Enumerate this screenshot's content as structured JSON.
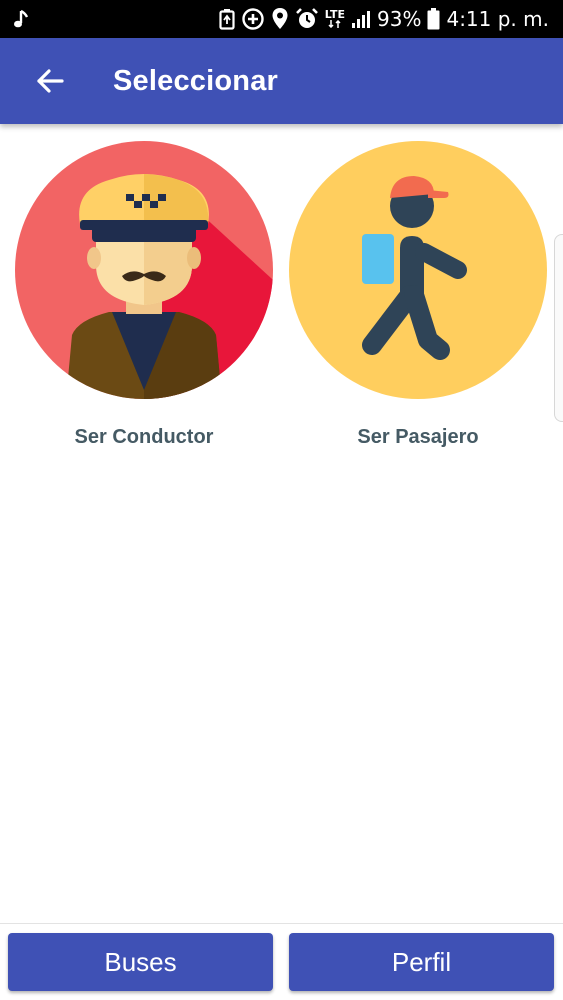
{
  "status_bar": {
    "battery_percent": "93%",
    "time": "4:11 p. m.",
    "network": "LTE",
    "icons": [
      "music-note-icon",
      "battery-saver-icon",
      "add-circle-icon",
      "location-icon",
      "alarm-icon",
      "lte-icon",
      "signal-icon",
      "battery-icon"
    ]
  },
  "app_bar": {
    "title": "Seleccionar",
    "back_icon": "arrow-back-icon",
    "color": "#3F51B5"
  },
  "options": [
    {
      "label": "Ser Conductor",
      "icon": "taxi-driver-avatar-icon",
      "color": "#F26464"
    },
    {
      "label": "Ser Pasajero",
      "icon": "walking-passenger-icon",
      "color": "#FFCE5E"
    }
  ],
  "bottom_bar": {
    "buses_label": "Buses",
    "perfil_label": "Perfil",
    "color": "#3F51B5"
  }
}
